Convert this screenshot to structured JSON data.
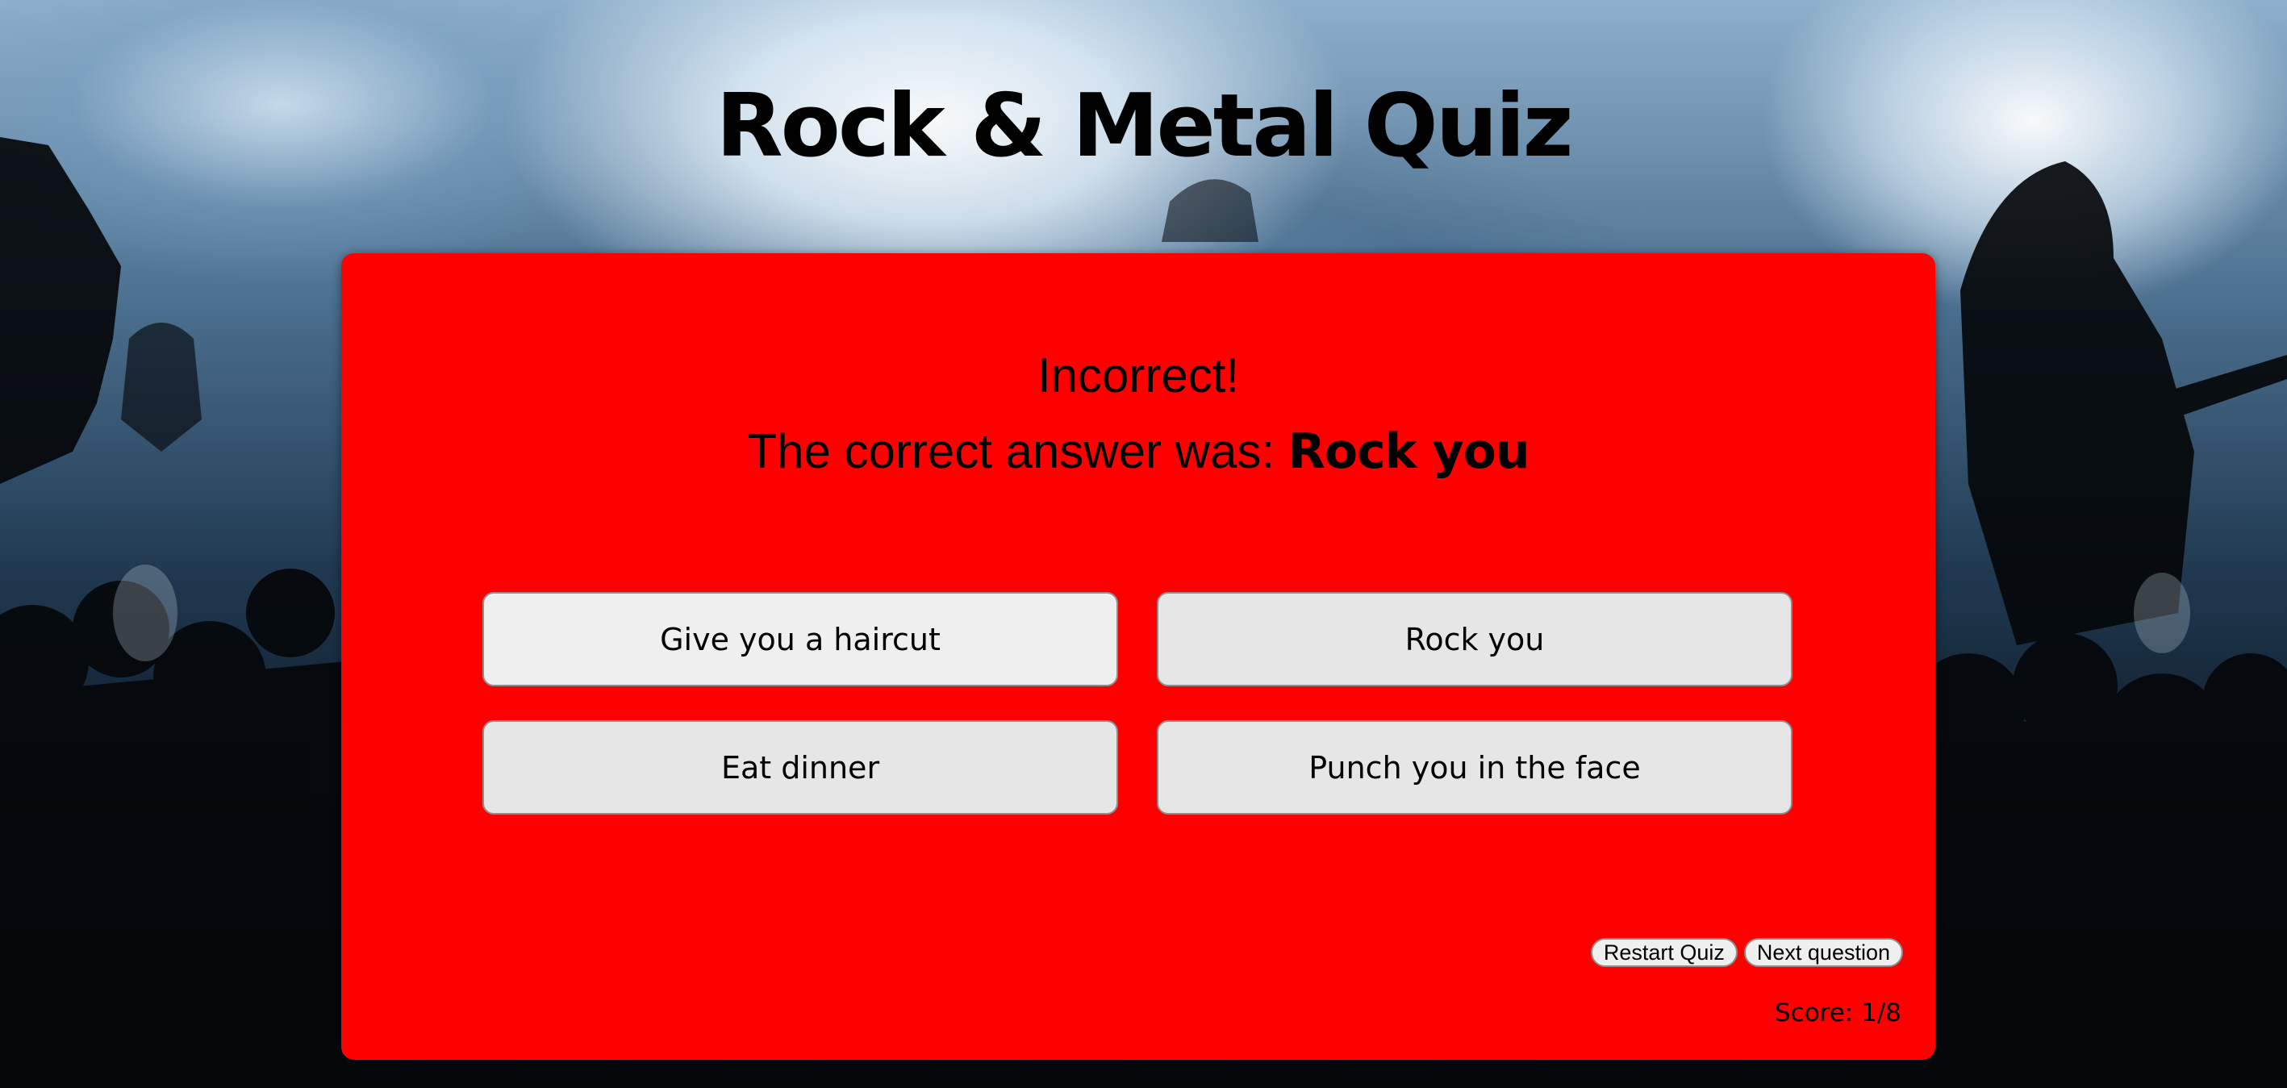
{
  "app": {
    "title": "Rock & Metal Quiz"
  },
  "result": {
    "status": "Incorrect!",
    "correct_prefix": "The correct answer was: ",
    "correct_answer": "Rock you"
  },
  "answers": [
    {
      "label": "Give you a haircut"
    },
    {
      "label": "Rock you"
    },
    {
      "label": "Eat dinner"
    },
    {
      "label": "Punch you in the face"
    }
  ],
  "controls": {
    "restart_label": "Restart Quiz",
    "next_label": "Next question"
  },
  "score": {
    "text": "Score: 1/8"
  },
  "colors": {
    "card": "#ff0000",
    "button": "#e6e6e6",
    "text": "#000000"
  }
}
